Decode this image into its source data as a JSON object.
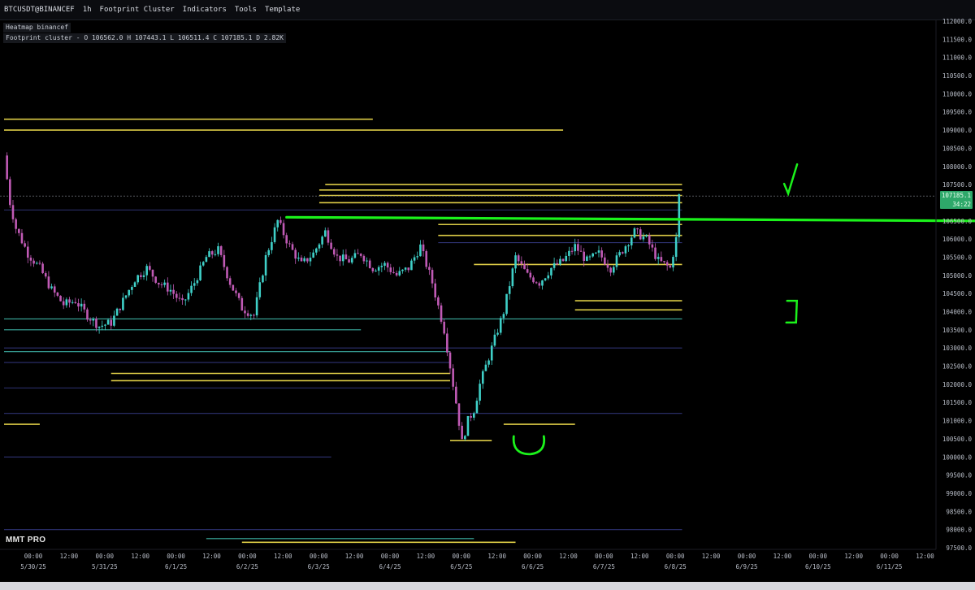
{
  "toolbar": {
    "symbol": "BTCUSDT@BINANCEF",
    "interval": "1h",
    "items": [
      "Footprint Cluster",
      "Indicators",
      "Tools",
      "Template"
    ]
  },
  "info": {
    "heatmap_label": "Heatmap binancef",
    "footprint_label": "Footprint cluster - O 106562.0 H 107443.1 L 106511.4 C 107185.1 D 2.82K"
  },
  "logo": "MMT PRO",
  "price_tag": {
    "price": "107185.1",
    "countdown": "34:22"
  },
  "colors": {
    "background": "#000000",
    "liquidity_strong": "#e8d64a",
    "liquidity_mid": "#3fb6a8",
    "liquidity_weak": "#3a3f8f",
    "annotation": "#1bf21b",
    "price_tag": "#2ea86a"
  },
  "chart_data": {
    "type": "heatmap",
    "symbol": "BTCUSDT@BINANCEF",
    "timeframe": "1h",
    "y_ticks": [
      112000,
      111500,
      111000,
      110500,
      110000,
      109500,
      109000,
      108500,
      108000,
      107500,
      107000,
      106500,
      106000,
      105500,
      105000,
      104500,
      104000,
      103500,
      103000,
      102500,
      102000,
      101500,
      101000,
      100500,
      100000,
      99500,
      99000,
      98500,
      98000,
      97500
    ],
    "ylim": [
      97500,
      112000
    ],
    "x_ticks": [
      {
        "time": "00:00",
        "date": "5/30/25"
      },
      {
        "time": "12:00",
        "date": ""
      },
      {
        "time": "00:00",
        "date": "5/31/25"
      },
      {
        "time": "12:00",
        "date": ""
      },
      {
        "time": "00:00",
        "date": "6/1/25"
      },
      {
        "time": "12:00",
        "date": ""
      },
      {
        "time": "00:00",
        "date": "6/2/25"
      },
      {
        "time": "12:00",
        "date": ""
      },
      {
        "time": "00:00",
        "date": "6/3/25"
      },
      {
        "time": "12:00",
        "date": ""
      },
      {
        "time": "00:00",
        "date": "6/4/25"
      },
      {
        "time": "12:00",
        "date": ""
      },
      {
        "time": "00:00",
        "date": "6/5/25"
      },
      {
        "time": "12:00",
        "date": ""
      },
      {
        "time": "00:00",
        "date": "6/6/25"
      },
      {
        "time": "12:00",
        "date": ""
      },
      {
        "time": "00:00",
        "date": "6/7/25"
      },
      {
        "time": "12:00",
        "date": ""
      },
      {
        "time": "00:00",
        "date": "6/8/25"
      },
      {
        "time": "12:00",
        "date": ""
      },
      {
        "time": "00:00",
        "date": "6/9/25"
      },
      {
        "time": "12:00",
        "date": ""
      },
      {
        "time": "00:00",
        "date": "6/10/25"
      },
      {
        "time": "12:00",
        "date": ""
      },
      {
        "time": "00:00",
        "date": "6/11/25"
      },
      {
        "time": "12:00",
        "date": ""
      }
    ],
    "price_path": [
      {
        "t": 0,
        "p": 108300
      },
      {
        "t": 2,
        "p": 107000
      },
      {
        "t": 4,
        "p": 106300
      },
      {
        "t": 8,
        "p": 105600
      },
      {
        "t": 12,
        "p": 105200
      },
      {
        "t": 16,
        "p": 104600
      },
      {
        "t": 20,
        "p": 104200
      },
      {
        "t": 24,
        "p": 104300
      },
      {
        "t": 28,
        "p": 103900
      },
      {
        "t": 32,
        "p": 103600
      },
      {
        "t": 36,
        "p": 103700
      },
      {
        "t": 40,
        "p": 104300
      },
      {
        "t": 44,
        "p": 104900
      },
      {
        "t": 48,
        "p": 105200
      },
      {
        "t": 52,
        "p": 104800
      },
      {
        "t": 56,
        "p": 104600
      },
      {
        "t": 60,
        "p": 104200
      },
      {
        "t": 64,
        "p": 104800
      },
      {
        "t": 68,
        "p": 105500
      },
      {
        "t": 72,
        "p": 105700
      },
      {
        "t": 76,
        "p": 104800
      },
      {
        "t": 80,
        "p": 104100
      },
      {
        "t": 84,
        "p": 103900
      },
      {
        "t": 88,
        "p": 105500
      },
      {
        "t": 92,
        "p": 106500
      },
      {
        "t": 96,
        "p": 105800
      },
      {
        "t": 100,
        "p": 105300
      },
      {
        "t": 104,
        "p": 105600
      },
      {
        "t": 108,
        "p": 106200
      },
      {
        "t": 112,
        "p": 105500
      },
      {
        "t": 116,
        "p": 105400
      },
      {
        "t": 120,
        "p": 105600
      },
      {
        "t": 124,
        "p": 105200
      },
      {
        "t": 128,
        "p": 105300
      },
      {
        "t": 132,
        "p": 105000
      },
      {
        "t": 136,
        "p": 105200
      },
      {
        "t": 140,
        "p": 105800
      },
      {
        "t": 144,
        "p": 104800
      },
      {
        "t": 148,
        "p": 103500
      },
      {
        "t": 152,
        "p": 101500
      },
      {
        "t": 154,
        "p": 100400
      },
      {
        "t": 156,
        "p": 101000
      },
      {
        "t": 158,
        "p": 101300
      },
      {
        "t": 160,
        "p": 102000
      },
      {
        "t": 164,
        "p": 103000
      },
      {
        "t": 168,
        "p": 104000
      },
      {
        "t": 172,
        "p": 105500
      },
      {
        "t": 176,
        "p": 105000
      },
      {
        "t": 180,
        "p": 104800
      },
      {
        "t": 184,
        "p": 105200
      },
      {
        "t": 188,
        "p": 105400
      },
      {
        "t": 192,
        "p": 105800
      },
      {
        "t": 196,
        "p": 105400
      },
      {
        "t": 200,
        "p": 105600
      },
      {
        "t": 204,
        "p": 105200
      },
      {
        "t": 208,
        "p": 105700
      },
      {
        "t": 212,
        "p": 106200
      },
      {
        "t": 216,
        "p": 106000
      },
      {
        "t": 220,
        "p": 105400
      },
      {
        "t": 224,
        "p": 105200
      },
      {
        "t": 226,
        "p": 106000
      },
      {
        "t": 227,
        "p": 107185
      }
    ],
    "liquidity_levels": [
      {
        "price": 109300,
        "from": 0,
        "to": 124,
        "color": "strong"
      },
      {
        "price": 109000,
        "from": 0,
        "to": 188,
        "color": "strong"
      },
      {
        "price": 107500,
        "from": 108,
        "to": 228,
        "color": "strong"
      },
      {
        "price": 107350,
        "from": 106,
        "to": 228,
        "color": "strong"
      },
      {
        "price": 107200,
        "from": 106,
        "to": 228,
        "color": "strong"
      },
      {
        "price": 107000,
        "from": 106,
        "to": 228,
        "color": "strong"
      },
      {
        "price": 106800,
        "from": 0,
        "to": 228,
        "color": "weak"
      },
      {
        "price": 106400,
        "from": 146,
        "to": 228,
        "color": "strong"
      },
      {
        "price": 106100,
        "from": 146,
        "to": 228,
        "color": "strong"
      },
      {
        "price": 105900,
        "from": 146,
        "to": 228,
        "color": "weak"
      },
      {
        "price": 105300,
        "from": 158,
        "to": 228,
        "color": "strong"
      },
      {
        "price": 104300,
        "from": 192,
        "to": 228,
        "color": "strong"
      },
      {
        "price": 104050,
        "from": 192,
        "to": 228,
        "color": "strong"
      },
      {
        "price": 103800,
        "from": 0,
        "to": 228,
        "color": "mid"
      },
      {
        "price": 103500,
        "from": 0,
        "to": 120,
        "color": "mid"
      },
      {
        "price": 103000,
        "from": 0,
        "to": 228,
        "color": "weak"
      },
      {
        "price": 102900,
        "from": 0,
        "to": 150,
        "color": "mid"
      },
      {
        "price": 102600,
        "from": 0,
        "to": 150,
        "color": "weak"
      },
      {
        "price": 102300,
        "from": 36,
        "to": 150,
        "color": "strong"
      },
      {
        "price": 102100,
        "from": 36,
        "to": 150,
        "color": "strong"
      },
      {
        "price": 101900,
        "from": 0,
        "to": 150,
        "color": "weak"
      },
      {
        "price": 101200,
        "from": 0,
        "to": 228,
        "color": "weak"
      },
      {
        "price": 100900,
        "from": 0,
        "to": 12,
        "color": "strong"
      },
      {
        "price": 100900,
        "from": 168,
        "to": 192,
        "color": "strong"
      },
      {
        "price": 100450,
        "from": 150,
        "to": 164,
        "color": "strong"
      },
      {
        "price": 100000,
        "from": 0,
        "to": 110,
        "color": "weak"
      },
      {
        "price": 98000,
        "from": 0,
        "to": 228,
        "color": "weak"
      },
      {
        "price": 97750,
        "from": 68,
        "to": 158,
        "color": "mid"
      },
      {
        "price": 97650,
        "from": 80,
        "to": 172,
        "color": "strong"
      }
    ],
    "annotations": {
      "support_line": {
        "price_start": 106600,
        "price_end": 106500,
        "from": 95,
        "to": 275
      },
      "checkmark": {
        "near_price": 107700,
        "t": 235
      },
      "bracket": {
        "price_top": 104300,
        "price_bottom": 103700,
        "t": 236
      },
      "bottom_circle": {
        "price": 100300,
        "t": 155
      }
    },
    "grid": false
  }
}
